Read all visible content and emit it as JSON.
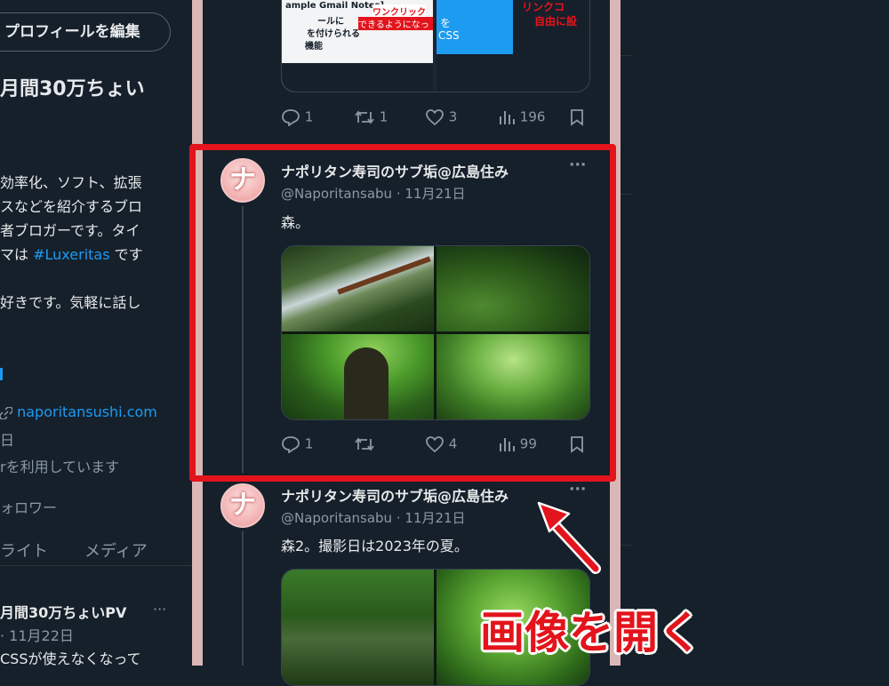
{
  "left": {
    "edit_profile": "プロフィールを編集",
    "name": "月間30万ちょい",
    "bio_lines": [
      "効率化、ソフト、拡張",
      "スなどを紹介するブロ",
      "者ブロガーです。タイ",
      "マは",
      "好きです。気軽に話し"
    ],
    "bio_hashtag": "#Luxeritas",
    "bio_hashtag_suffix": "です",
    "website": "naporitansushi.com",
    "joined_fragment": "日",
    "using_text": "rを利用しています",
    "followers_label": "ォロワー",
    "tab_highlights": "ライト",
    "tab_media": "メディア",
    "post_name": "月間30万ちょいPV",
    "post_more": "···",
    "post_date": "· 11月22日",
    "post_text": "CSSが使えなくなって"
  },
  "top_tweet": {
    "img_texts": [
      "ample Gmail Notes]",
      "ールに",
      "を付けられる",
      "機能",
      "ワンクリック",
      "できるようになっ",
      "を",
      "CSS",
      "リンクコ",
      "自由に設"
    ],
    "replies": "1",
    "retweets": "1",
    "likes": "3",
    "views": "196"
  },
  "tweet1": {
    "avatar_char": "ナ",
    "name": "ナポリタン寿司のサブ垢@広島住み",
    "more": "···",
    "handle": "@Naporitansabu · 11月21日",
    "text": "森。",
    "replies": "1",
    "retweets": "",
    "likes": "4",
    "views": "99"
  },
  "tweet2": {
    "avatar_char": "ナ",
    "name": "ナポリタン寿司のサブ垢@広島住み",
    "more": "···",
    "handle": "@Naporitansabu · 11月21日",
    "text": "森2。撮影日は2023年の夏。"
  },
  "annotation": {
    "callout": "画像を開く"
  },
  "colors": {
    "background": "#15202b",
    "accent": "#1d9bf0",
    "highlight_red": "#e3141c"
  }
}
